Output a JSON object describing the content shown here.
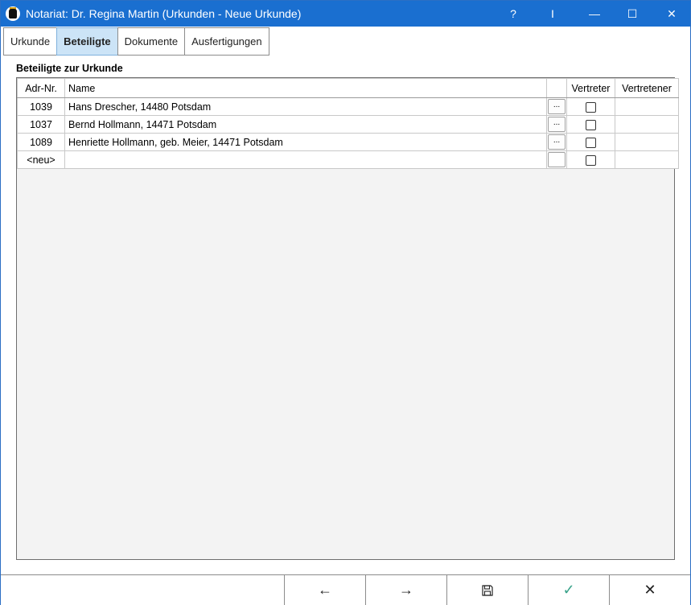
{
  "window": {
    "title": "Notariat: Dr. Regina Martin (Urkunden - Neue Urkunde)",
    "controls": {
      "help": "?",
      "cursor": "I",
      "minimize": "—",
      "maximize": "☐",
      "close": "✕"
    }
  },
  "tabs": [
    {
      "label": "Urkunde",
      "active": false
    },
    {
      "label": "Beteiligte",
      "active": true
    },
    {
      "label": "Dokumente",
      "active": false
    },
    {
      "label": "Ausfertigungen",
      "active": false
    }
  ],
  "section_title": "Beteiligte zur Urkunde",
  "table": {
    "headers": {
      "adr_nr": "Adr-Nr.",
      "name": "Name",
      "vertreter": "Vertreter",
      "vertretener": "Vertretener"
    },
    "rows": [
      {
        "adr_nr": "1039",
        "name": "Hans Drescher, 14480 Potsdam",
        "dots": "...",
        "vertreter": false,
        "vertretener": ""
      },
      {
        "adr_nr": "1037",
        "name": "Bernd Hollmann, 14471 Potsdam",
        "dots": "...",
        "vertreter": false,
        "vertretener": ""
      },
      {
        "adr_nr": "1089",
        "name": "Henriette Hollmann, geb. Meier, 14471 Potsdam",
        "dots": "...",
        "vertreter": false,
        "vertretener": ""
      },
      {
        "adr_nr": "<neu>",
        "name": "",
        "dots": "",
        "vertreter": false,
        "vertretener": ""
      }
    ]
  },
  "bottom_bar": {
    "back": "←",
    "forward": "→",
    "save": "💾",
    "ok": "✓",
    "cancel": "✕"
  },
  "colors": {
    "titlebar": "#1a6fd0",
    "active_tab": "#cce4f7",
    "ok_check": "#3aa38a"
  }
}
